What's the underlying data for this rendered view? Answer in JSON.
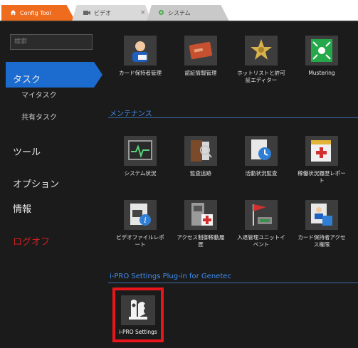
{
  "tabs": [
    {
      "label": "Config Tool",
      "icon": "home-icon"
    },
    {
      "label": "ビデオ",
      "icon": "video-icon"
    },
    {
      "label": "システム",
      "icon": "system-icon"
    }
  ],
  "sidebar": {
    "search_placeholder": "検索",
    "items": {
      "task": "タスク",
      "my_task": "マイタスク",
      "shared_task": "共有タスク",
      "tools": "ツール",
      "options": "オプション",
      "info": "情報",
      "logoff": "ログオフ"
    }
  },
  "content": {
    "top_tiles": [
      {
        "label": "カード保持者管理",
        "icon": "cardholder-icon"
      },
      {
        "label": "認証情報管理",
        "icon": "credential-icon"
      },
      {
        "label": "ホットリストと許可証エディター",
        "icon": "hotlist-badge-icon"
      },
      {
        "label": "Mustering",
        "icon": "mustering-icon"
      }
    ],
    "maintenance": {
      "header": "メンテナンス",
      "tiles": [
        {
          "label": "システム状況",
          "icon": "system-status-icon"
        },
        {
          "label": "監査追跡",
          "icon": "audit-trail-icon"
        },
        {
          "label": "活動状況監査",
          "icon": "activity-audit-icon"
        },
        {
          "label": "稼働状況履歴レポート",
          "icon": "health-history-icon"
        },
        {
          "label": "ビデオファイルレポート",
          "icon": "video-file-report-icon"
        },
        {
          "label": "アクセス制御稼動履歴",
          "icon": "access-control-health-icon"
        },
        {
          "label": "入退管理ユニットイベント",
          "icon": "access-unit-event-icon"
        },
        {
          "label": "カード保持者アクセス権限",
          "icon": "cardholder-access-rights-icon"
        }
      ]
    },
    "plugin": {
      "header": "i-PRO Settings Plug-in for Genetec",
      "tile": {
        "label": "i-PRO Settings",
        "icon": "ipro-settings-icon"
      }
    }
  },
  "colors": {
    "accent_blue": "#1c6cd0",
    "tab_orange": "#ef6c1f",
    "logoff_red": "#cf1f1f",
    "highlight_red": "#e8161b"
  }
}
